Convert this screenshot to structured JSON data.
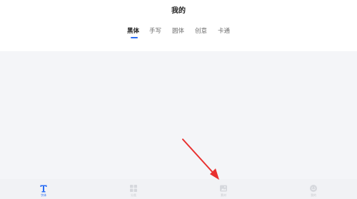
{
  "header": {
    "title": "我的"
  },
  "tabs": [
    {
      "label": "黑体",
      "active": true
    },
    {
      "label": "手写",
      "active": false
    },
    {
      "label": "圆体",
      "active": false
    },
    {
      "label": "创意",
      "active": false
    },
    {
      "label": "卡通",
      "active": false
    }
  ],
  "bottom_nav": {
    "items": [
      {
        "label": "字体",
        "icon": "font-icon",
        "active": true
      },
      {
        "label": "分类",
        "icon": "grid-icon",
        "active": false
      },
      {
        "label": "素材",
        "icon": "image-icon",
        "active": false
      },
      {
        "label": "我的",
        "icon": "face-icon",
        "active": false
      }
    ]
  },
  "colors": {
    "accent": "#2a6df4",
    "annotation_arrow": "#e8302f",
    "background": "#f4f5f8"
  }
}
